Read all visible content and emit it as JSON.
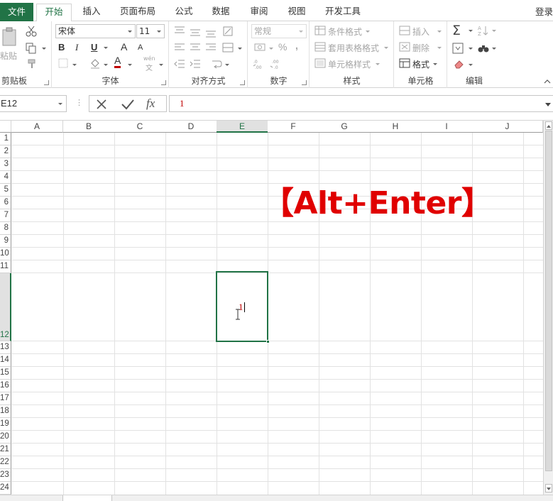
{
  "tabs": {
    "file": "文件",
    "home": "开始",
    "insert": "插入",
    "page_layout": "页面布局",
    "formulas": "公式",
    "data": "数据",
    "review": "审阅",
    "view": "视图",
    "developer": "开发工具",
    "login": "登录"
  },
  "ribbon": {
    "clipboard": {
      "label": "剪贴板",
      "paste": "粘贴"
    },
    "font": {
      "label": "字体",
      "font_name": "宋体",
      "font_size": "11",
      "bold": "B",
      "italic": "I",
      "underline": "U",
      "grow": "A",
      "shrink": "A",
      "font_color_letter": "A",
      "wen": "wén",
      "wen_char": "文"
    },
    "alignment": {
      "label": "对齐方式"
    },
    "number": {
      "label": "数字",
      "format": "常规",
      "percent": "%",
      "comma": ","
    },
    "styles": {
      "label": "样式",
      "conditional": "条件格式",
      "table": "套用表格格式",
      "cell_styles": "单元格样式"
    },
    "cells": {
      "label": "单元格",
      "insert": "插入",
      "delete": "删除",
      "format": "格式"
    },
    "editing": {
      "label": "编辑"
    }
  },
  "formula_bar": {
    "name_box": "E12",
    "formula": "1"
  },
  "grid": {
    "columns": [
      "A",
      "B",
      "C",
      "D",
      "E",
      "F",
      "G",
      "H",
      "I",
      "J"
    ],
    "selected_column": "E",
    "rows": [
      "1",
      "2",
      "3",
      "4",
      "5",
      "6",
      "7",
      "8",
      "9",
      "10",
      "11",
      "12",
      "13",
      "14",
      "15",
      "16",
      "17",
      "18",
      "19",
      "20",
      "21",
      "22",
      "23",
      "24"
    ],
    "selected_row": "12",
    "active_cell_value": "1"
  },
  "overlay": "【Alt+Enter】",
  "colors": {
    "excel_green": "#217346",
    "overlay_red": "#e00000",
    "value_red": "#c00000"
  }
}
